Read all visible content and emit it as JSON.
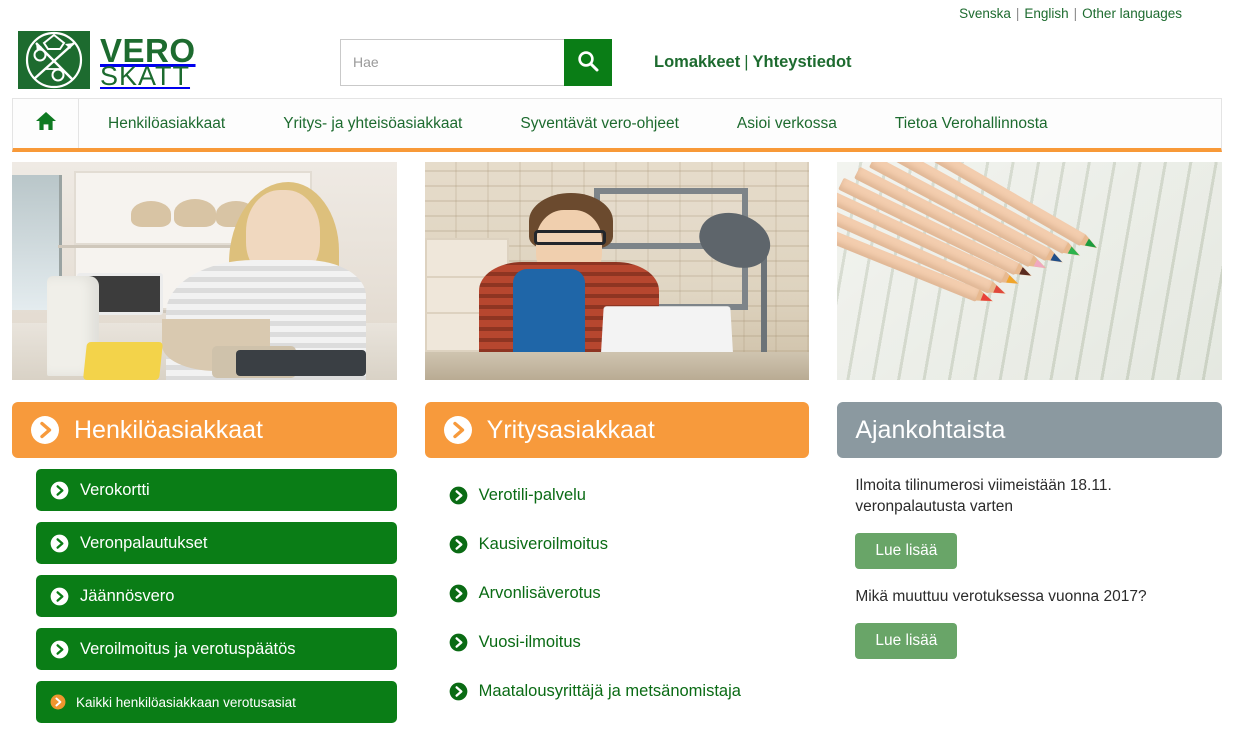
{
  "topbar": {
    "languages": [
      {
        "label": "Svenska",
        "name": "lang-svenska"
      },
      {
        "label": "English",
        "name": "lang-english"
      },
      {
        "label": "Other languages",
        "name": "lang-other"
      }
    ],
    "separator": "|"
  },
  "header": {
    "logo": {
      "line1": "VERO",
      "line2": "SKATT",
      "icon": "vero-crest-icon",
      "color": "#1d6b2f"
    },
    "search": {
      "placeholder": "Hae",
      "value": "",
      "button_icon": "search-icon"
    },
    "links": [
      {
        "label": "Lomakkeet",
        "name": "header-link-lomakkeet"
      },
      {
        "label": "Yhteystiedot",
        "name": "header-link-yhteystiedot"
      }
    ],
    "link_separator": "|"
  },
  "nav": {
    "home_icon": "home-icon",
    "accent_color": "#f89938",
    "items": [
      {
        "label": "Henkilöasiakkaat",
        "name": "nav-item-henkiloasiakkaat"
      },
      {
        "label": "Yritys- ja yhteisöasiakkaat",
        "name": "nav-item-yritys-ja-yhteisoasiakkaat"
      },
      {
        "label": "Syventävät vero-ohjeet",
        "name": "nav-item-syventavat-vero-ohjeet"
      },
      {
        "label": "Asioi verkossa",
        "name": "nav-item-asioi-verkossa"
      },
      {
        "label": "Tietoa Verohallinnosta",
        "name": "nav-item-tietoa-verohallinnosta"
      }
    ]
  },
  "heroes": [
    {
      "name": "hero-image-henkiloasiakkaat",
      "alt": "Nainen leipomassa keittiössä tabletin kanssa"
    },
    {
      "name": "hero-image-yritysasiakkaat",
      "alt": "Yrittäjä työpöydän ääressä kannettavan tietokoneen kanssa"
    },
    {
      "name": "hero-image-ajankohtaista",
      "alt": "Värikyniä puupinnalla"
    }
  ],
  "columns": {
    "personal": {
      "title": "Henkilöasiakkaat",
      "header_color": "#f79a3c",
      "icon": "circle-arrow-icon",
      "buttons": [
        {
          "label": "Verokortti",
          "name": "button-verokortti",
          "icon": "circle-arrow-icon",
          "small": false
        },
        {
          "label": "Veronpalautukset",
          "name": "button-veronpalautukset",
          "icon": "circle-arrow-icon",
          "small": false
        },
        {
          "label": "Jäännösvero",
          "name": "button-jaannosvero",
          "icon": "circle-arrow-icon",
          "small": false
        },
        {
          "label": "Veroilmoitus ja verotuspäätös",
          "name": "button-veroilmoitus-ja-verotuspaatos",
          "icon": "circle-arrow-icon",
          "small": false
        },
        {
          "label": "Kaikki henkilöasiakkaan verotusasiat",
          "name": "button-kaikki-henkiloasiakkaan-verotusasiat",
          "icon": "circle-arrow-icon-orange",
          "small": true
        }
      ]
    },
    "business": {
      "title": "Yritysasiakkaat",
      "header_color": "#f79a3c",
      "icon": "circle-arrow-icon",
      "links": [
        {
          "label": "Verotili-palvelu",
          "name": "link-verotili-palvelu",
          "icon": "circle-arrow-icon"
        },
        {
          "label": "Kausiveroilmoitus",
          "name": "link-kausiveroilmoitus",
          "icon": "circle-arrow-icon"
        },
        {
          "label": "Arvonlisäverotus",
          "name": "link-arvonlisaverotus",
          "icon": "circle-arrow-icon"
        },
        {
          "label": "Vuosi-ilmoitus",
          "name": "link-vuosi-ilmoitus",
          "icon": "circle-arrow-icon"
        },
        {
          "label": "Maatalousyrittäjä ja metsänomistaja",
          "name": "link-maatalousyrittaja-ja-metsanomistaja",
          "icon": "circle-arrow-icon"
        }
      ]
    },
    "news": {
      "title": "Ajankohtaista",
      "header_color": "#8b99a0",
      "items": [
        {
          "text": "Ilmoita tilinumerosi viimeistään 18.11. veronpalautusta varten",
          "button_label": "Lue lisää",
          "name": "news-item-tilinumero"
        },
        {
          "text": "Mikä muuttuu verotuksessa vuonna 2017?",
          "button_label": "Lue lisää",
          "name": "news-item-muutokset-2017"
        }
      ]
    }
  },
  "colors": {
    "brand_green": "#0a7d16",
    "dark_green": "#1d6b2f",
    "orange": "#f79a3c",
    "accent_orange": "#f89938",
    "gray_header": "#8b99a0",
    "readmore_green": "#69a568"
  }
}
